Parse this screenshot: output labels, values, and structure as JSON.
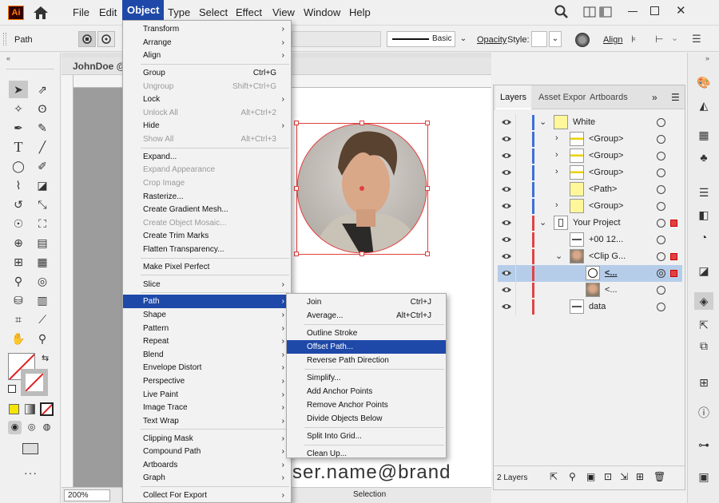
{
  "app": {
    "logo": "Ai",
    "home_icon": "home-icon"
  },
  "menubar": {
    "items": [
      "File",
      "Edit",
      "Object",
      "Type",
      "Select",
      "Effect",
      "View",
      "Window",
      "Help"
    ],
    "active": "Object"
  },
  "controlbar": {
    "selection_type": "Path",
    "stroke_style": "Basic",
    "opacity_label": "Opacity",
    "style_label": "Style:",
    "align_label": "Align"
  },
  "document": {
    "tab_title": "JohnDoe @",
    "zoom": "200%",
    "status_tool": "Selection",
    "email_text": "ser.name@brand"
  },
  "object_menu": {
    "items": [
      {
        "label": "Transform",
        "sub": true
      },
      {
        "label": "Arrange",
        "sub": true
      },
      {
        "label": "Align",
        "sub": true
      },
      {
        "sep": true
      },
      {
        "label": "Group",
        "shortcut": "Ctrl+G"
      },
      {
        "label": "Ungroup",
        "shortcut": "Shift+Ctrl+G",
        "disabled": true
      },
      {
        "label": "Lock",
        "sub": true
      },
      {
        "label": "Unlock All",
        "shortcut": "Alt+Ctrl+2",
        "disabled": true
      },
      {
        "label": "Hide",
        "sub": true
      },
      {
        "label": "Show All",
        "shortcut": "Alt+Ctrl+3",
        "disabled": true
      },
      {
        "sep": true
      },
      {
        "label": "Expand..."
      },
      {
        "label": "Expand Appearance",
        "disabled": true
      },
      {
        "label": "Crop Image",
        "disabled": true
      },
      {
        "label": "Rasterize..."
      },
      {
        "label": "Create Gradient Mesh..."
      },
      {
        "label": "Create Object Mosaic...",
        "disabled": true
      },
      {
        "label": "Create Trim Marks"
      },
      {
        "label": "Flatten Transparency..."
      },
      {
        "sep": true
      },
      {
        "label": "Make Pixel Perfect"
      },
      {
        "sep": true
      },
      {
        "label": "Slice",
        "sub": true
      },
      {
        "sep": true
      },
      {
        "label": "Path",
        "sub": true,
        "highlight": true
      },
      {
        "label": "Shape",
        "sub": true
      },
      {
        "label": "Pattern",
        "sub": true
      },
      {
        "label": "Repeat",
        "sub": true
      },
      {
        "label": "Blend",
        "sub": true
      },
      {
        "label": "Envelope Distort",
        "sub": true
      },
      {
        "label": "Perspective",
        "sub": true
      },
      {
        "label": "Live Paint",
        "sub": true
      },
      {
        "label": "Image Trace",
        "sub": true
      },
      {
        "label": "Text Wrap",
        "sub": true
      },
      {
        "sep": true
      },
      {
        "label": "Clipping Mask",
        "sub": true
      },
      {
        "label": "Compound Path",
        "sub": true
      },
      {
        "label": "Artboards",
        "sub": true
      },
      {
        "label": "Graph",
        "sub": true
      },
      {
        "sep": true
      },
      {
        "label": "Collect For Export",
        "sub": true
      }
    ]
  },
  "path_submenu": {
    "items": [
      {
        "label": "Join",
        "shortcut": "Ctrl+J"
      },
      {
        "label": "Average...",
        "shortcut": "Alt+Ctrl+J"
      },
      {
        "sep": true
      },
      {
        "label": "Outline Stroke"
      },
      {
        "label": "Offset Path...",
        "highlight": true
      },
      {
        "label": "Reverse Path Direction"
      },
      {
        "sep": true
      },
      {
        "label": "Simplify..."
      },
      {
        "label": "Add Anchor Points"
      },
      {
        "label": "Remove Anchor Points"
      },
      {
        "label": "Divide Objects Below"
      },
      {
        "sep": true
      },
      {
        "label": "Split Into Grid..."
      },
      {
        "sep": true
      },
      {
        "label": "Clean Up..."
      }
    ]
  },
  "layers_panel": {
    "tabs": [
      "Layers",
      "Asset Expor",
      "Artboards"
    ],
    "active_tab": "Layers",
    "footer_count": "2 Layers",
    "rows": [
      {
        "name": "White",
        "level": 0,
        "color": "#3c6fd8",
        "expanded": true,
        "thumb": "yellow"
      },
      {
        "name": "<Group>",
        "level": 1,
        "color": "#3c6fd8",
        "thumb": "yellowline"
      },
      {
        "name": "<Group>",
        "level": 1,
        "color": "#3c6fd8",
        "thumb": "yellowline"
      },
      {
        "name": "<Group>",
        "level": 1,
        "color": "#3c6fd8",
        "thumb": "yellowline"
      },
      {
        "name": "<Path>",
        "level": 1,
        "color": "#3c6fd8",
        "thumb": "yellow",
        "noexpand": true
      },
      {
        "name": "<Group>",
        "level": 1,
        "color": "#3c6fd8",
        "thumb": "yellow"
      },
      {
        "name": "Your Project",
        "level": 0,
        "color": "#e04444",
        "expanded": true,
        "thumb": "doc",
        "selsq": true
      },
      {
        "name": "+00 12...",
        "level": 1,
        "color": "#e04444",
        "thumb": "text",
        "noexpand": true
      },
      {
        "name": "<Clip G...",
        "level": 1,
        "color": "#e04444",
        "expanded": true,
        "thumb": "face",
        "selsq": true
      },
      {
        "name": "<...",
        "level": 2,
        "color": "#e04444",
        "thumb": "circle",
        "selected": true,
        "selsq": true,
        "underline": true
      },
      {
        "name": "<...",
        "level": 2,
        "color": "#e04444",
        "thumb": "face"
      },
      {
        "name": "data",
        "level": 1,
        "color": "#e04444",
        "thumb": "text",
        "noexpand": true
      }
    ]
  }
}
